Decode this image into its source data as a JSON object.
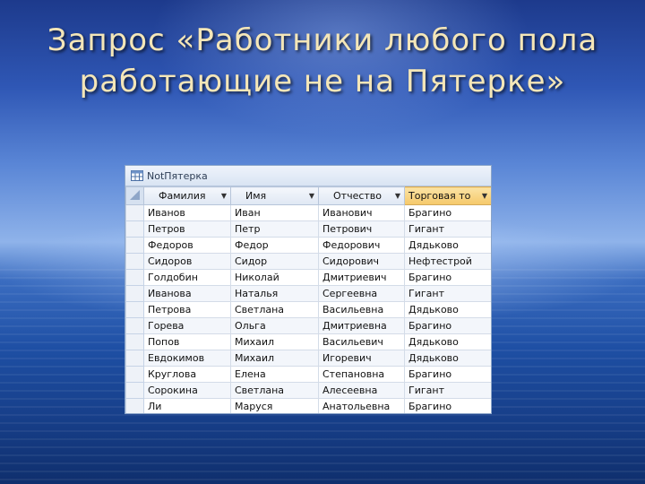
{
  "slide": {
    "title_line1": "Запрос «Работники любого пола",
    "title_line2": "работающие не на Пятерке»"
  },
  "window": {
    "tab_label": "NotПятерка",
    "tab_icon": "table-icon"
  },
  "table": {
    "columns": [
      "Фамилия",
      "Имя",
      "Отчество",
      "Торговая то"
    ],
    "selected_column": 3,
    "rows": [
      [
        "Иванов",
        "Иван",
        "Иванович",
        "Брагино"
      ],
      [
        "Петров",
        "Петр",
        "Петрович",
        "Гигант"
      ],
      [
        "Федоров",
        "Федор",
        "Федорович",
        "Дядьково"
      ],
      [
        "Сидоров",
        "Сидор",
        "Сидорович",
        "Нефтестрой"
      ],
      [
        "Голдобин",
        "Николай",
        "Дмитриевич",
        "Брагино"
      ],
      [
        "Иванова",
        "Наталья",
        "Сергеевна",
        "Гигант"
      ],
      [
        "Петрова",
        "Светлана",
        "Васильевна",
        "Дядьково"
      ],
      [
        "Горева",
        "Ольга",
        "Дмитриевна",
        "Брагино"
      ],
      [
        "Попов",
        "Михаил",
        "Васильевич",
        "Дядьково"
      ],
      [
        "Евдокимов",
        "Михаил",
        "Игоревич",
        "Дядьково"
      ],
      [
        "Круглова",
        "Елена",
        "Степановна",
        "Брагино"
      ],
      [
        "Сорокина",
        "Светлана",
        "Алесеевна",
        "Гигант"
      ],
      [
        "Ли",
        "Маруся",
        "Анатольевна",
        "Брагино"
      ]
    ]
  },
  "colors": {
    "selected_header": "#f5c86a",
    "title_text": "#f4e6b8"
  }
}
